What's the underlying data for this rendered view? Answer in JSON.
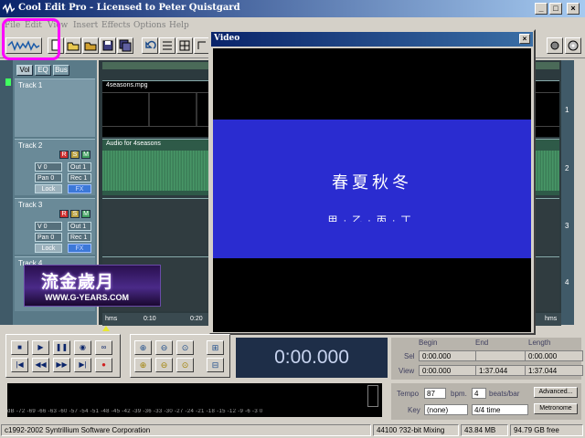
{
  "window": {
    "title": "Cool Edit Pro  -  Licensed to Peter Quistgard"
  },
  "menu": [
    "File",
    "Edit",
    "View",
    "Insert",
    "Effects",
    "Options",
    "Help"
  ],
  "panel_tabs": [
    "Vol",
    "EQ",
    "Bus"
  ],
  "tracks": [
    {
      "name": "Track 1",
      "clip": "4seasons.mpg"
    },
    {
      "name": "Track 2",
      "clip": "Audio for 4seasons",
      "vol": "V 0",
      "pan": "Pan 0",
      "out": "Out 1",
      "rec": "Rec 1",
      "lock": "Lock",
      "fx": "FX"
    },
    {
      "name": "Track 3",
      "vol": "V 0",
      "pan": "Pan 0",
      "out": "Out 1",
      "rec": "Rec 1",
      "lock": "Lock",
      "fx": "FX"
    },
    {
      "name": "Track 4"
    }
  ],
  "rsm": [
    "R",
    "S",
    "M"
  ],
  "vertical_numbers": [
    "1",
    "2",
    "3",
    "4"
  ],
  "video_window": {
    "title": "Video",
    "subtitle_main": "春夏秋冬",
    "subtitle_sub": "甲·乙·丙·丁"
  },
  "logo": {
    "chinese": "流金歲月",
    "url": "WWW.G-YEARS.COM"
  },
  "timeline": {
    "ticks": [
      "hms",
      "0:10",
      "0:20",
      "hms"
    ]
  },
  "time_display": "0:00.000",
  "selection": {
    "headers": [
      "Begin",
      "End",
      "Length"
    ],
    "sel_label": "Sel",
    "view_label": "View",
    "sel": [
      "0:00.000",
      "",
      "0:00.000"
    ],
    "view": [
      "0:00.000",
      "1:37.044",
      "1:37.044"
    ]
  },
  "tempo": {
    "label": "Tempo",
    "value": "87",
    "bpm": "bpm.",
    "beats": "4",
    "beats_label": "beats/bar",
    "advanced": "Advanced...",
    "key_label": "Key",
    "key": "(none)",
    "time_sig": "4/4 time",
    "metronome": "Metronome"
  },
  "meter_scale": "dB -72 -69 -66 -63 -60 -57 -54 -51 -48 -45 -42 -39 -36 -33 -30 -27 -24 -21 -18 -15 -12 -9 -6 -3 0",
  "status": {
    "copyright": "c1992-2002 Syntrillium Software Corporation",
    "format": "44100 ?32-bit Mixing",
    "mem": "43.84 MB",
    "free": "94.79 GB free"
  },
  "colors": {
    "accent": "#0a246a",
    "highlight_box": "#ff00ff",
    "video_blue": "#2a2cd0",
    "wave_green": "#3a8a5a"
  }
}
